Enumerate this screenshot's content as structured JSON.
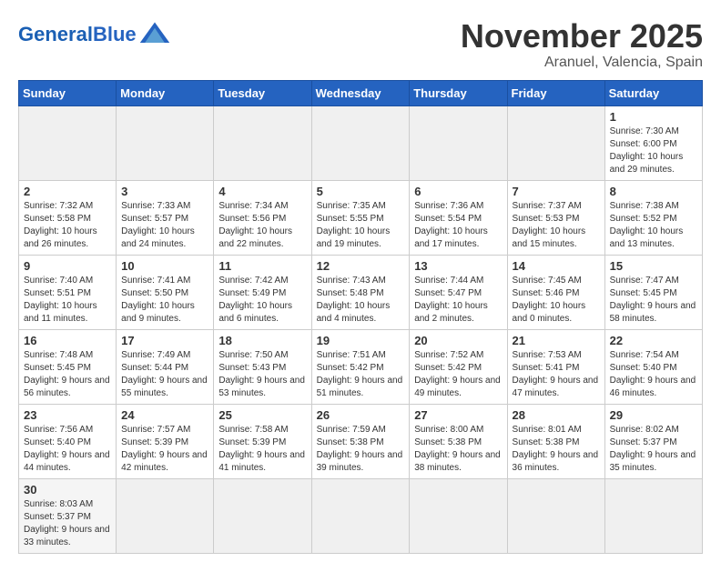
{
  "header": {
    "logo_general": "General",
    "logo_blue": "Blue",
    "month_title": "November 2025",
    "location": "Aranuel, Valencia, Spain"
  },
  "weekdays": [
    "Sunday",
    "Monday",
    "Tuesday",
    "Wednesday",
    "Thursday",
    "Friday",
    "Saturday"
  ],
  "weeks": [
    [
      {
        "day": "",
        "info": ""
      },
      {
        "day": "",
        "info": ""
      },
      {
        "day": "",
        "info": ""
      },
      {
        "day": "",
        "info": ""
      },
      {
        "day": "",
        "info": ""
      },
      {
        "day": "",
        "info": ""
      },
      {
        "day": "1",
        "info": "Sunrise: 7:30 AM\nSunset: 6:00 PM\nDaylight: 10 hours and 29 minutes."
      }
    ],
    [
      {
        "day": "2",
        "info": "Sunrise: 7:32 AM\nSunset: 5:58 PM\nDaylight: 10 hours and 26 minutes."
      },
      {
        "day": "3",
        "info": "Sunrise: 7:33 AM\nSunset: 5:57 PM\nDaylight: 10 hours and 24 minutes."
      },
      {
        "day": "4",
        "info": "Sunrise: 7:34 AM\nSunset: 5:56 PM\nDaylight: 10 hours and 22 minutes."
      },
      {
        "day": "5",
        "info": "Sunrise: 7:35 AM\nSunset: 5:55 PM\nDaylight: 10 hours and 19 minutes."
      },
      {
        "day": "6",
        "info": "Sunrise: 7:36 AM\nSunset: 5:54 PM\nDaylight: 10 hours and 17 minutes."
      },
      {
        "day": "7",
        "info": "Sunrise: 7:37 AM\nSunset: 5:53 PM\nDaylight: 10 hours and 15 minutes."
      },
      {
        "day": "8",
        "info": "Sunrise: 7:38 AM\nSunset: 5:52 PM\nDaylight: 10 hours and 13 minutes."
      }
    ],
    [
      {
        "day": "9",
        "info": "Sunrise: 7:40 AM\nSunset: 5:51 PM\nDaylight: 10 hours and 11 minutes."
      },
      {
        "day": "10",
        "info": "Sunrise: 7:41 AM\nSunset: 5:50 PM\nDaylight: 10 hours and 9 minutes."
      },
      {
        "day": "11",
        "info": "Sunrise: 7:42 AM\nSunset: 5:49 PM\nDaylight: 10 hours and 6 minutes."
      },
      {
        "day": "12",
        "info": "Sunrise: 7:43 AM\nSunset: 5:48 PM\nDaylight: 10 hours and 4 minutes."
      },
      {
        "day": "13",
        "info": "Sunrise: 7:44 AM\nSunset: 5:47 PM\nDaylight: 10 hours and 2 minutes."
      },
      {
        "day": "14",
        "info": "Sunrise: 7:45 AM\nSunset: 5:46 PM\nDaylight: 10 hours and 0 minutes."
      },
      {
        "day": "15",
        "info": "Sunrise: 7:47 AM\nSunset: 5:45 PM\nDaylight: 9 hours and 58 minutes."
      }
    ],
    [
      {
        "day": "16",
        "info": "Sunrise: 7:48 AM\nSunset: 5:45 PM\nDaylight: 9 hours and 56 minutes."
      },
      {
        "day": "17",
        "info": "Sunrise: 7:49 AM\nSunset: 5:44 PM\nDaylight: 9 hours and 55 minutes."
      },
      {
        "day": "18",
        "info": "Sunrise: 7:50 AM\nSunset: 5:43 PM\nDaylight: 9 hours and 53 minutes."
      },
      {
        "day": "19",
        "info": "Sunrise: 7:51 AM\nSunset: 5:42 PM\nDaylight: 9 hours and 51 minutes."
      },
      {
        "day": "20",
        "info": "Sunrise: 7:52 AM\nSunset: 5:42 PM\nDaylight: 9 hours and 49 minutes."
      },
      {
        "day": "21",
        "info": "Sunrise: 7:53 AM\nSunset: 5:41 PM\nDaylight: 9 hours and 47 minutes."
      },
      {
        "day": "22",
        "info": "Sunrise: 7:54 AM\nSunset: 5:40 PM\nDaylight: 9 hours and 46 minutes."
      }
    ],
    [
      {
        "day": "23",
        "info": "Sunrise: 7:56 AM\nSunset: 5:40 PM\nDaylight: 9 hours and 44 minutes."
      },
      {
        "day": "24",
        "info": "Sunrise: 7:57 AM\nSunset: 5:39 PM\nDaylight: 9 hours and 42 minutes."
      },
      {
        "day": "25",
        "info": "Sunrise: 7:58 AM\nSunset: 5:39 PM\nDaylight: 9 hours and 41 minutes."
      },
      {
        "day": "26",
        "info": "Sunrise: 7:59 AM\nSunset: 5:38 PM\nDaylight: 9 hours and 39 minutes."
      },
      {
        "day": "27",
        "info": "Sunrise: 8:00 AM\nSunset: 5:38 PM\nDaylight: 9 hours and 38 minutes."
      },
      {
        "day": "28",
        "info": "Sunrise: 8:01 AM\nSunset: 5:38 PM\nDaylight: 9 hours and 36 minutes."
      },
      {
        "day": "29",
        "info": "Sunrise: 8:02 AM\nSunset: 5:37 PM\nDaylight: 9 hours and 35 minutes."
      }
    ],
    [
      {
        "day": "30",
        "info": "Sunrise: 8:03 AM\nSunset: 5:37 PM\nDaylight: 9 hours and 33 minutes."
      },
      {
        "day": "",
        "info": ""
      },
      {
        "day": "",
        "info": ""
      },
      {
        "day": "",
        "info": ""
      },
      {
        "day": "",
        "info": ""
      },
      {
        "day": "",
        "info": ""
      },
      {
        "day": "",
        "info": ""
      }
    ]
  ]
}
